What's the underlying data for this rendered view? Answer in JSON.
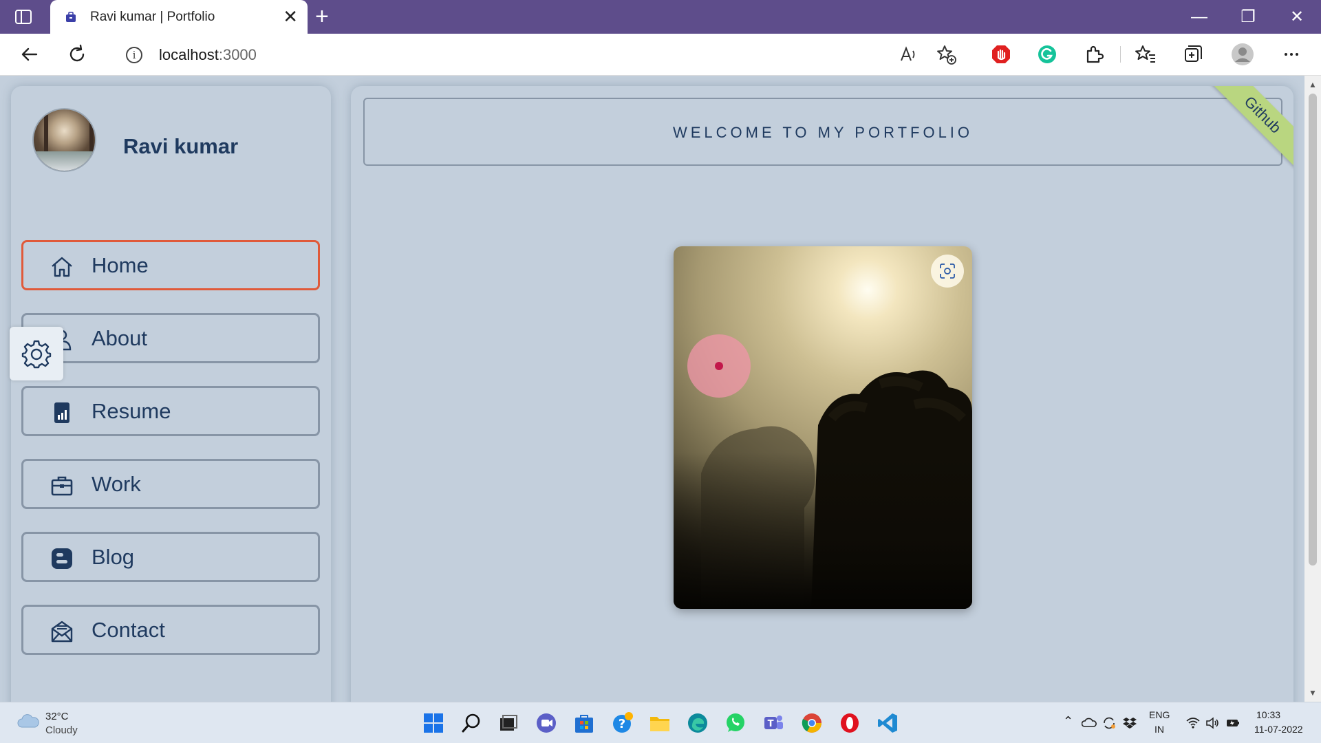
{
  "browser": {
    "tab_title": "Ravi kumar | Portfolio",
    "tab_close": "✕",
    "new_tab": "+",
    "window_controls": {
      "minimize": "—",
      "restore": "❐",
      "close": "✕"
    },
    "url_host": "localhost",
    "url_port": ":3000"
  },
  "sidebar": {
    "profile_name": "Ravi kumar",
    "nav": [
      {
        "label": "Home",
        "icon": "home-icon",
        "active": true
      },
      {
        "label": "About",
        "icon": "user-icon",
        "active": false
      },
      {
        "label": "Resume",
        "icon": "chart-file-icon",
        "active": false
      },
      {
        "label": "Work",
        "icon": "briefcase-icon",
        "active": false
      },
      {
        "label": "Blog",
        "icon": "blogger-icon",
        "active": false
      },
      {
        "label": "Contact",
        "icon": "mail-open-icon",
        "active": false
      }
    ]
  },
  "main": {
    "welcome": "WELCOME TO MY PORTFOLIO",
    "ribbon": "Github"
  },
  "taskbar": {
    "weather_temp": "32°C",
    "weather_desc": "Cloudy",
    "lang_top": "ENG",
    "lang_bottom": "IN",
    "time": "10:33",
    "date": "11-07-2022"
  },
  "colors": {
    "page_bg": "#c3cfdc",
    "accent_text": "#1f3a5f",
    "active_border": "#e05a3a",
    "ribbon": "#b9d680",
    "titlebar": "#5e4d8b"
  }
}
